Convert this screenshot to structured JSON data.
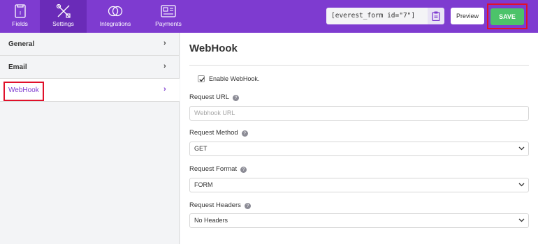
{
  "topbar": {
    "tabs": [
      {
        "label": "Fields",
        "icon": "fields-icon"
      },
      {
        "label": "Settings",
        "icon": "settings-icon",
        "active": true
      },
      {
        "label": "Integrations",
        "icon": "integrations-icon"
      },
      {
        "label": "Payments",
        "icon": "payments-icon"
      }
    ],
    "shortcode": "[everest_form id=\"7\"]",
    "preview_label": "Preview",
    "save_label": "SAVE"
  },
  "sidebar": {
    "items": [
      {
        "label": "General"
      },
      {
        "label": "Email"
      },
      {
        "label": "WebHook",
        "active": true
      }
    ]
  },
  "main": {
    "title": "WebHook",
    "enable_label": "Enable WebHook.",
    "enable_checked": true,
    "request_url": {
      "label": "Request URL",
      "placeholder": "Webhook URL"
    },
    "request_method": {
      "label": "Request Method",
      "value": "GET"
    },
    "request_format": {
      "label": "Request Format",
      "value": "FORM"
    },
    "request_headers": {
      "label": "Request Headers",
      "value": "No Headers"
    }
  },
  "colors": {
    "accent": "#7e3bd0",
    "save": "#4cc36a",
    "highlight": "#e0102a"
  }
}
